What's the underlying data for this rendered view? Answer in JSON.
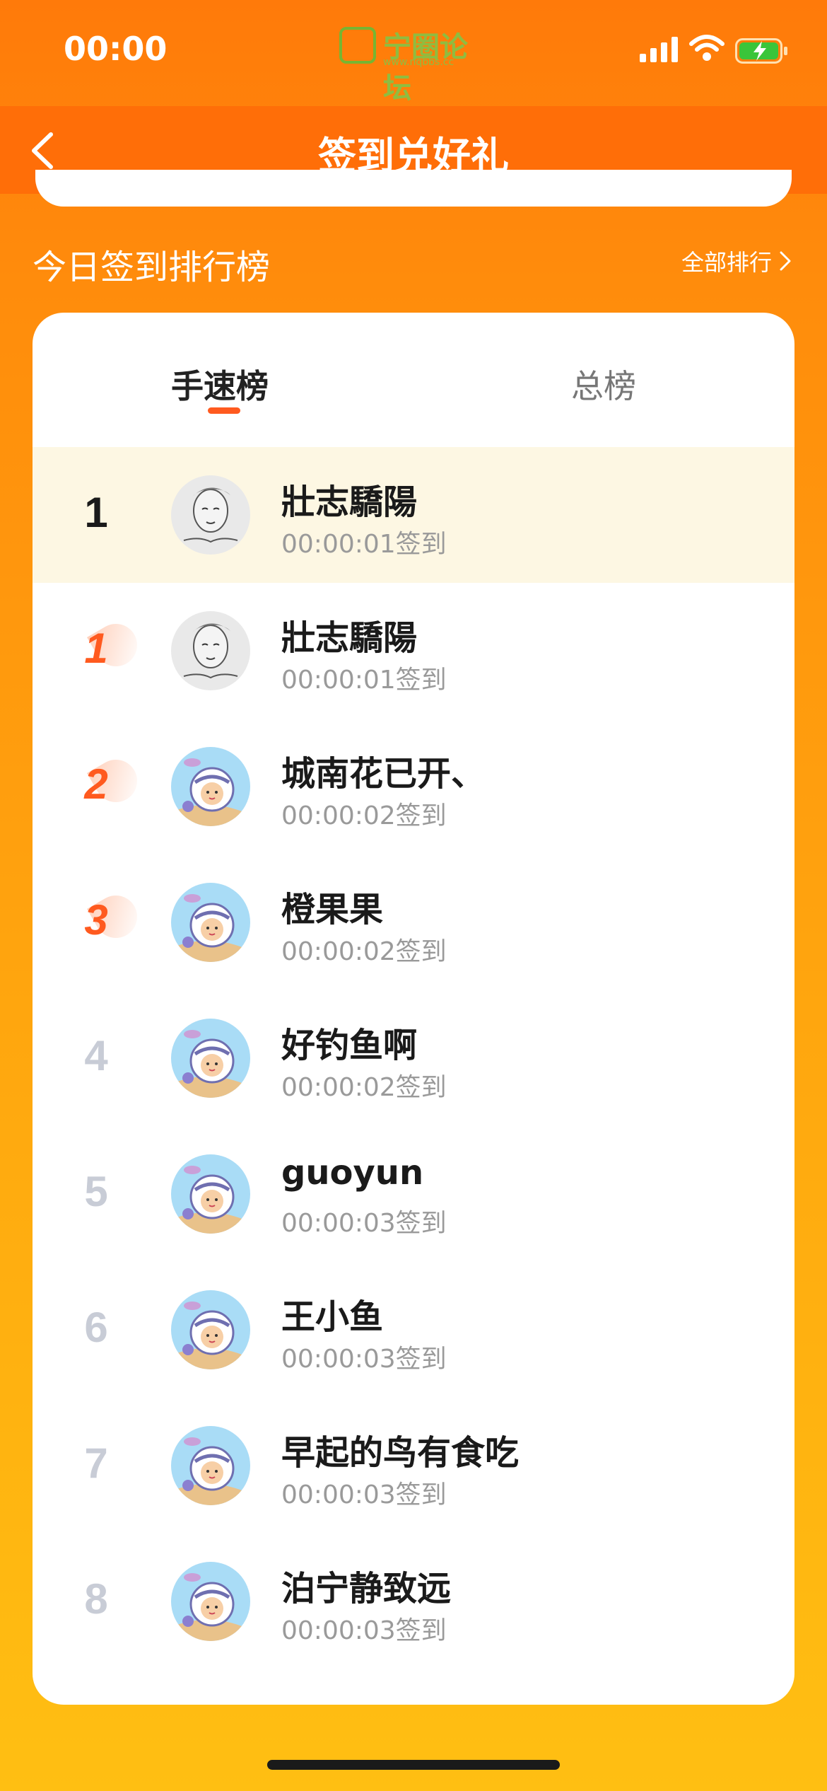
{
  "status": {
    "time": "00:00",
    "watermark": "宁圈论坛",
    "watermark_sub": "www.nqbbs.cc"
  },
  "nav": {
    "title": "签到兑好礼"
  },
  "section": {
    "title": "今日签到排行榜",
    "all_rank": "全部排行"
  },
  "tabs": [
    {
      "label": "手速榜",
      "active": true
    },
    {
      "label": "总榜",
      "active": false
    }
  ],
  "rows": [
    {
      "rank": "1",
      "name": "壯志驕陽",
      "time": "00:00:01签到",
      "avatar": "sketch"
    },
    {
      "rank": "1",
      "name": "壯志驕陽",
      "time": "00:00:01签到",
      "avatar": "sketch"
    },
    {
      "rank": "2",
      "name": "城南花已开、",
      "time": "00:00:02签到",
      "avatar": "astronaut"
    },
    {
      "rank": "3",
      "name": "橙果果",
      "time": "00:00:02签到",
      "avatar": "astronaut"
    },
    {
      "rank": "4",
      "name": "好钓鱼啊",
      "time": "00:00:02签到",
      "avatar": "astronaut"
    },
    {
      "rank": "5",
      "name": "guoyun",
      "time": "00:00:03签到",
      "avatar": "astronaut"
    },
    {
      "rank": "6",
      "name": "王小鱼",
      "time": "00:00:03签到",
      "avatar": "astronaut"
    },
    {
      "rank": "7",
      "name": "早起的鸟有食吃",
      "time": "00:00:03签到",
      "avatar": "astronaut"
    },
    {
      "rank": "8",
      "name": "泊宁静致远",
      "time": "00:00:03签到",
      "avatar": "astronaut"
    }
  ],
  "colors": {
    "accent": "#ff5a1f",
    "nav_bg": "#ff6e08",
    "highlight_row": "#fdf7e3"
  }
}
